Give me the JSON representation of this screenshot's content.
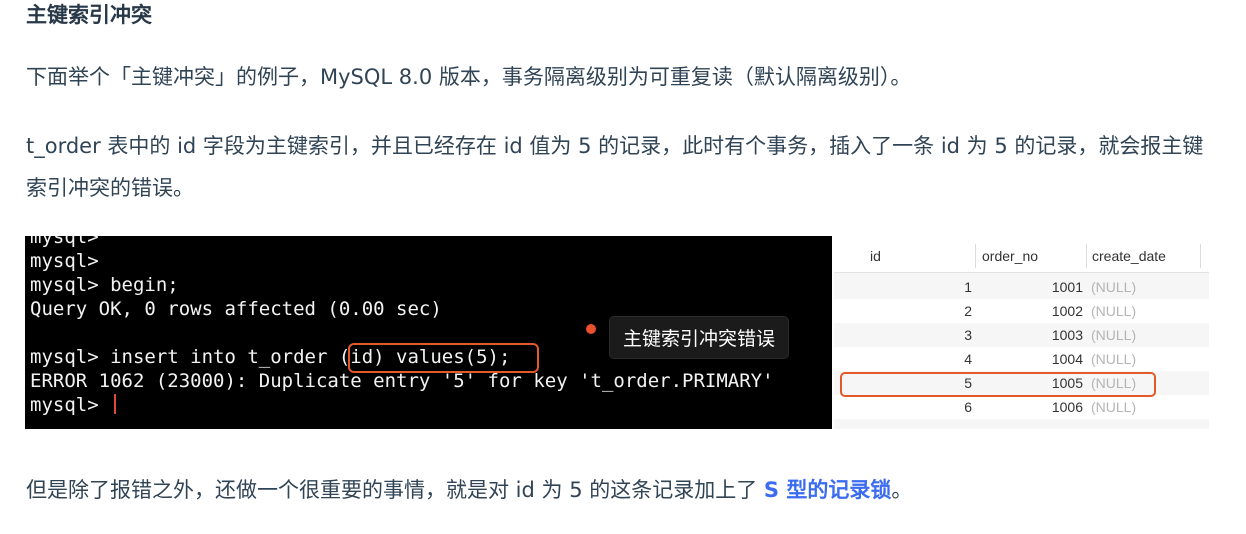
{
  "heading": "主键索引冲突",
  "paragraphs": {
    "p1": "下面举个「主键冲突」的例子，MySQL 8.0 版本，事务隔离级别为可重复读（默认隔离级别）。",
    "p2": "t_order 表中的 id 字段为主键索引，并且已经存在 id 值为 5 的记录，此时有个事务，插入了一条 id 为 5 的记录，就会报主键索引冲突的错误。",
    "p3_before": "但是除了报错之外，还做一个很重要的事情，就是对 id 为 5 的这条记录加上了 ",
    "p3_link": "S 型的记录锁",
    "p3_after": "。"
  },
  "terminal": {
    "lines": [
      "mysql>",
      "mysql>",
      "mysql> begin;",
      "Query OK, 0 rows affected (0.00 sec)",
      "",
      "mysql> insert into t_order (id) values(5);",
      "ERROR 1062 (23000): Duplicate entry '5' for key 't_order.PRIMARY'",
      "mysql> "
    ],
    "annotation": "主键索引冲突错误"
  },
  "db_table": {
    "columns": [
      "id",
      "order_no",
      "create_date"
    ],
    "rows": [
      {
        "id": "1",
        "order_no": "1001",
        "create_date": "(NULL)"
      },
      {
        "id": "2",
        "order_no": "1002",
        "create_date": "(NULL)"
      },
      {
        "id": "3",
        "order_no": "1003",
        "create_date": "(NULL)"
      },
      {
        "id": "4",
        "order_no": "1004",
        "create_date": "(NULL)"
      },
      {
        "id": "5",
        "order_no": "1005",
        "create_date": "(NULL)"
      },
      {
        "id": "6",
        "order_no": "1006",
        "create_date": "(NULL)"
      }
    ]
  },
  "colors": {
    "highlight": "#e05b29",
    "link": "#3b6cf0"
  }
}
